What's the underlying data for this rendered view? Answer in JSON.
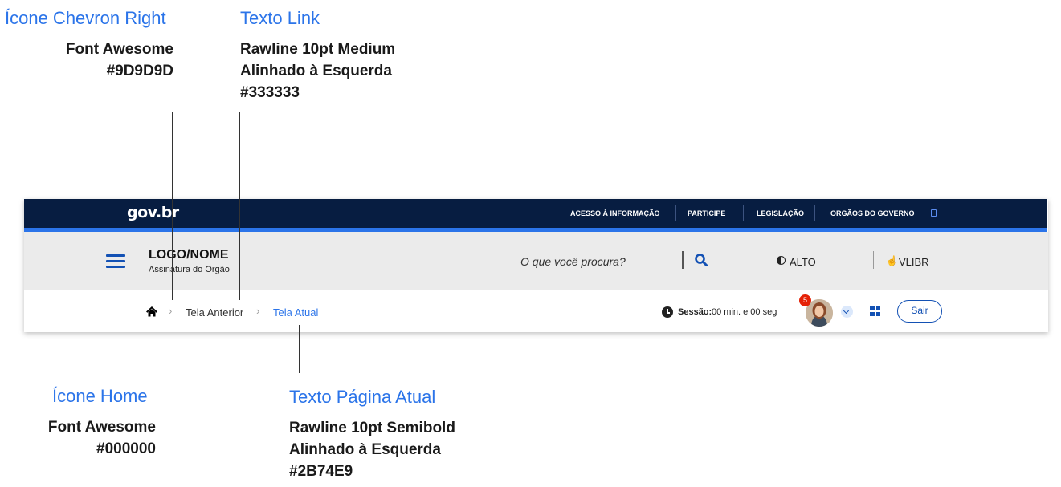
{
  "annotations": {
    "chevron": {
      "title": "Ícone Chevron Right",
      "lines": [
        "Font Awesome",
        "#9D9D9D"
      ]
    },
    "link": {
      "title": "Texto Link",
      "lines": [
        "Rawline 10pt Medium",
        "Alinhado à Esquerda",
        "#333333"
      ]
    },
    "home": {
      "title": "Ícone Home",
      "lines": [
        "Font Awesome",
        "#000000"
      ]
    },
    "current": {
      "title": "Texto Página Atual",
      "lines": [
        "Rawline 10pt Semibold",
        "Alinhado à Esquerda",
        "#2B74E9"
      ]
    }
  },
  "topbar": {
    "brand": "gov.br",
    "links": [
      "ACESSO À INFORMAÇÃO",
      "PARTICIPE",
      "LEGISLAÇÃO",
      "ORGÃOS DO GOVERNO"
    ]
  },
  "header": {
    "logo": "LOGO/NOME",
    "org": "Assinatura do Orgão",
    "search_placeholder": "O que você procura?",
    "contrast_label": "ALTO",
    "vlibras_label": "VLIBR"
  },
  "breadcrumb": {
    "previous": "Tela Anterior",
    "current": "Tela Atual",
    "separator": "›"
  },
  "session": {
    "label": "Sessão:",
    "value": "00 min. e 00 seg"
  },
  "user": {
    "notification_count": "5",
    "logout_label": "Sair"
  },
  "colors": {
    "topbar": "#071D41",
    "accent": "#2B74E9",
    "primary": "#1351B4",
    "chevron": "#9D9D9D",
    "link": "#333333",
    "home": "#000000",
    "badge": "#E52207"
  },
  "icons": [
    "chevron-right-icon",
    "home-icon",
    "menu-icon",
    "search-icon",
    "contrast-icon",
    "sign-language-icon",
    "clock-icon",
    "chevron-down-icon",
    "apps-grid-icon"
  ]
}
